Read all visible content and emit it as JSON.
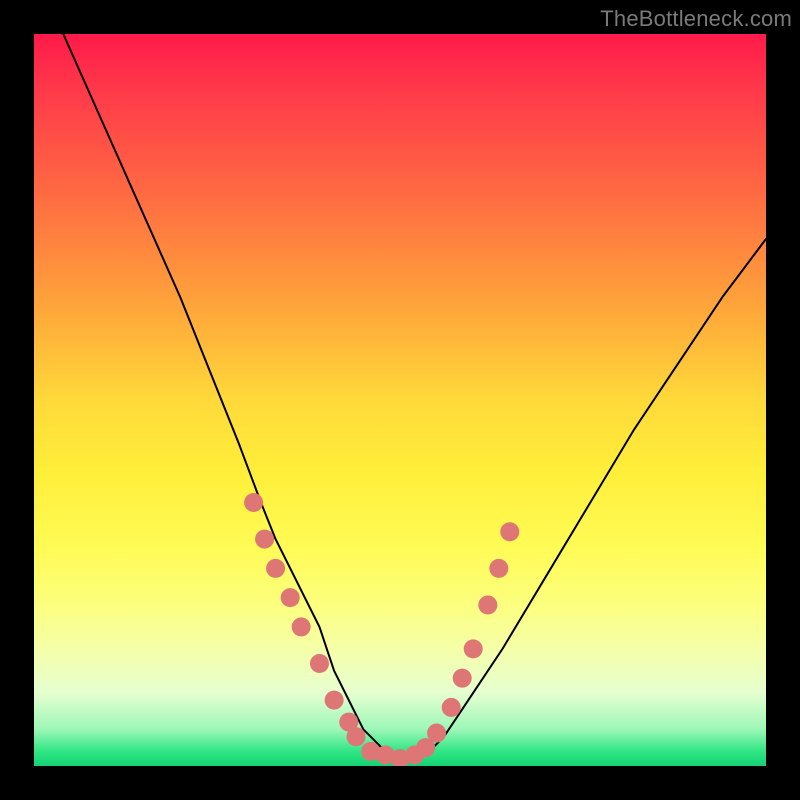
{
  "watermark": "TheBottleneck.com",
  "chart_data": {
    "type": "line",
    "title": "",
    "xlabel": "",
    "ylabel": "",
    "xlim": [
      0,
      100
    ],
    "ylim": [
      0,
      100
    ],
    "series": [
      {
        "name": "curve",
        "x": [
          4,
          8,
          12,
          16,
          20,
          24,
          28,
          31,
          33,
          35,
          37,
          39,
          40,
          41,
          42,
          43,
          44,
          45,
          46,
          47,
          48,
          50,
          52,
          54,
          56,
          58,
          60,
          64,
          70,
          76,
          82,
          88,
          94,
          100
        ],
        "y": [
          100,
          91,
          82,
          73,
          64,
          54,
          44,
          36,
          31,
          27,
          23,
          19,
          16,
          13,
          11,
          9,
          7,
          5,
          4,
          3,
          2,
          1,
          1,
          2,
          4,
          7,
          10,
          16,
          26,
          36,
          46,
          55,
          64,
          72
        ]
      }
    ],
    "highlight_points": {
      "name": "dots",
      "color": "#df7676",
      "points": [
        {
          "x": 30,
          "y": 36
        },
        {
          "x": 31.5,
          "y": 31
        },
        {
          "x": 33,
          "y": 27
        },
        {
          "x": 35,
          "y": 23
        },
        {
          "x": 36.5,
          "y": 19
        },
        {
          "x": 39,
          "y": 14
        },
        {
          "x": 41,
          "y": 9
        },
        {
          "x": 43,
          "y": 6
        },
        {
          "x": 44,
          "y": 4
        },
        {
          "x": 46,
          "y": 2
        },
        {
          "x": 48,
          "y": 1.5
        },
        {
          "x": 50,
          "y": 1
        },
        {
          "x": 52,
          "y": 1.5
        },
        {
          "x": 53.5,
          "y": 2.5
        },
        {
          "x": 55,
          "y": 4.5
        },
        {
          "x": 57,
          "y": 8
        },
        {
          "x": 58.5,
          "y": 12
        },
        {
          "x": 60,
          "y": 16
        },
        {
          "x": 62,
          "y": 22
        },
        {
          "x": 63.5,
          "y": 27
        },
        {
          "x": 65,
          "y": 32
        }
      ]
    }
  }
}
